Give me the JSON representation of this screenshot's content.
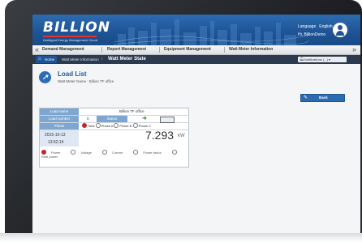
{
  "header": {
    "logo": "BILLION",
    "tagline": "Intelligent Energy Management Cloud",
    "language_label": "Language",
    "language_value": "English",
    "user": "Hi, BillionDemo"
  },
  "nav": {
    "items": [
      "Demand Management",
      "Report Management",
      "Equipment Management",
      "Watt Meter Information"
    ]
  },
  "breadcrumb": {
    "home": "Home",
    "level1": "Watt Meter Information",
    "current": "Watt Meter State",
    "notifications": "Notifications (...)"
  },
  "page": {
    "title": "Load List",
    "subtitle": "Watt Meter Name : Billion TF office",
    "back_label": "Back"
  },
  "load": {
    "name_label": "Load name",
    "name_value": "Billion TF office",
    "number_label": "Load number",
    "number_value": "0",
    "status_label": "Status",
    "phase_label": "Phase",
    "phases": [
      {
        "label": "Total",
        "selected": true
      },
      {
        "label": "Phase A",
        "selected": false
      },
      {
        "label": "Phase B",
        "selected": false
      },
      {
        "label": "Phase C",
        "selected": false
      }
    ],
    "date": "2015-10-13",
    "time": "13:52:14",
    "power_value": "7.293",
    "power_unit": "kW",
    "metrics": [
      {
        "label": "Power",
        "selected": true
      },
      {
        "label": "Voltage",
        "selected": false
      },
      {
        "label": "Current",
        "selected": false
      },
      {
        "label": "Power factor",
        "selected": false
      },
      {
        "label": "Real power",
        "selected": false
      }
    ]
  },
  "colors": {
    "header_blue": "#1f5597",
    "label_blue": "#7da7d1",
    "status_green": "#2e9b2e",
    "radio_red": "#c0262a"
  }
}
